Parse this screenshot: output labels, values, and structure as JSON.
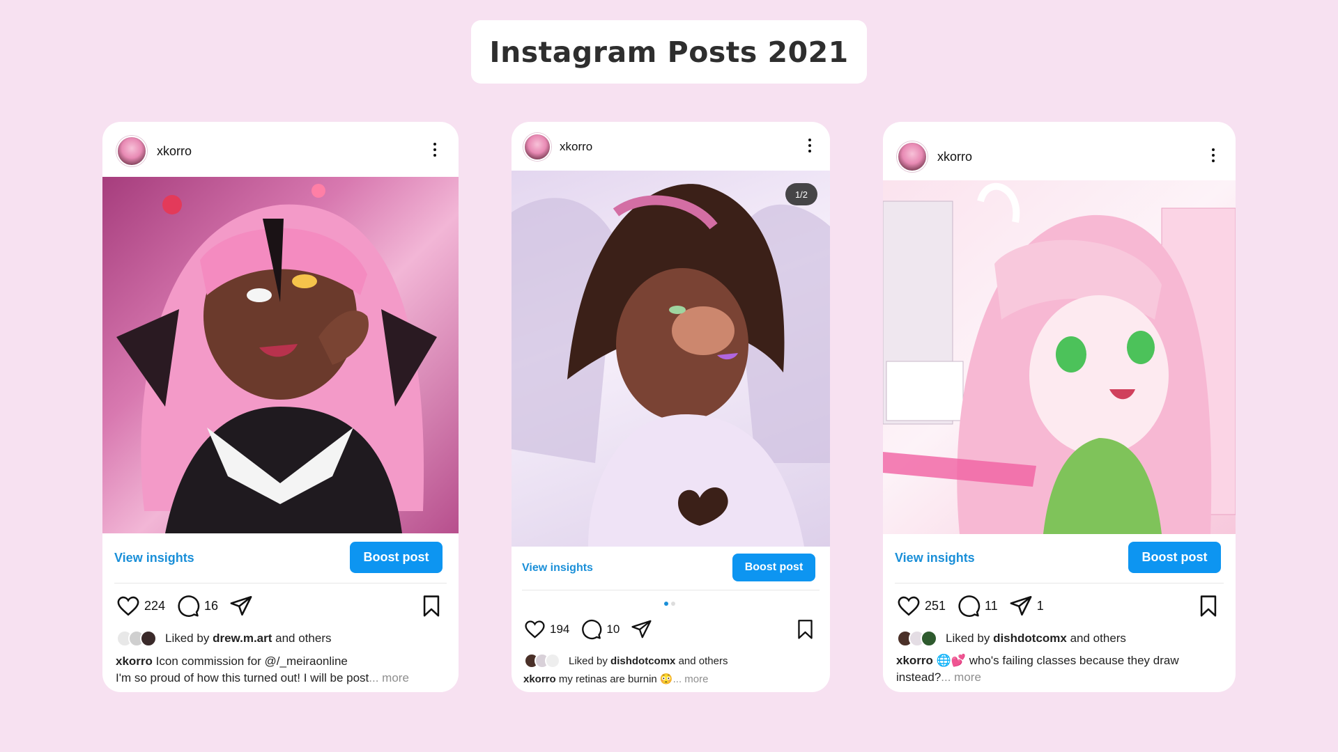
{
  "page": {
    "title": "Instagram Posts 2021"
  },
  "posts": [
    {
      "username": "xkorro",
      "insights_label": "View insights",
      "boost_label": "Boost post",
      "likes": "224",
      "comments": "16",
      "shares": "",
      "liked_prefix": "Liked by",
      "liked_user": "drew.m.art",
      "liked_suffix": "and others",
      "caption_user": "xkorro",
      "caption_line1": "Icon commission for @/_meiraonline",
      "caption_line2": "I'm so proud of how this turned out! I will be post",
      "more": "... more",
      "image_colors": [
        "#c2508e",
        "#f6a6cf",
        "#2b1a1d",
        "#6b3a2c"
      ]
    },
    {
      "username": "xkorro",
      "insights_label": "View insights",
      "boost_label": "Boost post",
      "likes": "194",
      "comments": "10",
      "shares": "",
      "carousel_badge": "1/2",
      "liked_prefix": "Liked by",
      "liked_user": "dishdotcomx",
      "liked_suffix": "and others",
      "caption_user": "xkorro",
      "caption_line1": "my retinas are burnin 😳",
      "more": "... more",
      "image_colors": [
        "#e9def0",
        "#5e3426",
        "#d36ea4",
        "#ffffff"
      ]
    },
    {
      "username": "xkorro",
      "insights_label": "View insights",
      "boost_label": "Boost post",
      "likes": "251",
      "comments": "11",
      "shares": "1",
      "liked_prefix": "Liked by",
      "liked_user": "dishdotcomx",
      "liked_suffix": "and others",
      "caption_user": "xkorro",
      "caption_line1": "🌐💕 who's failing classes because they draw",
      "caption_line2": "instead?",
      "more": "... more",
      "image_colors": [
        "#f6c3d8",
        "#f08db6",
        "#7fc35a",
        "#ffffff"
      ]
    }
  ],
  "colors": {
    "background": "#f7e1f1",
    "accent": "#0d95f1",
    "link": "#1a8fd8"
  },
  "icons": [
    "heart-icon",
    "comment-icon",
    "share-icon",
    "bookmark-icon",
    "more-options-icon"
  ]
}
